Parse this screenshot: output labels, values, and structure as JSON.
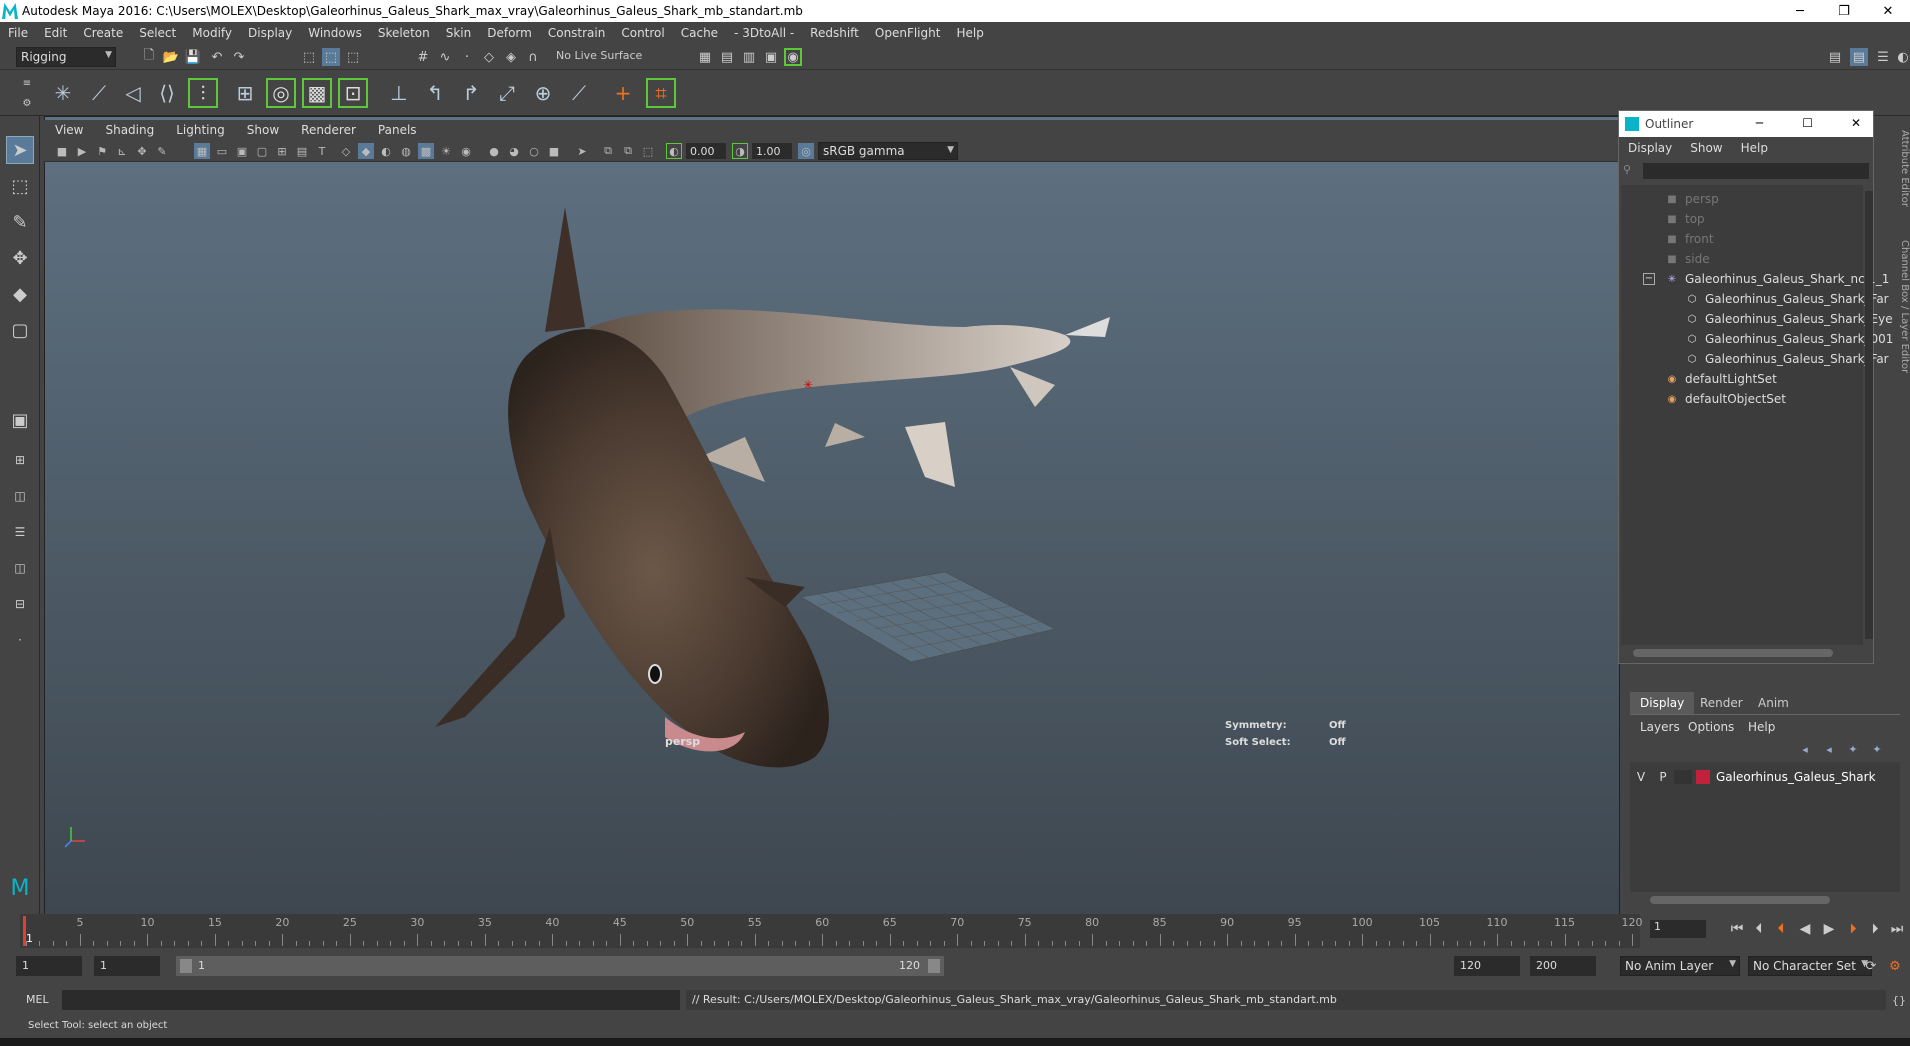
{
  "window": {
    "title": "Autodesk Maya 2016: C:\\Users\\MOLEX\\Desktop\\Galeorhinus_Galeus_Shark_max_vray\\Galeorhinus_Galeus_Shark_mb_standart.mb",
    "minimize": "─",
    "restore": "❐",
    "close": "✕"
  },
  "menubar": [
    "File",
    "Edit",
    "Create",
    "Select",
    "Modify",
    "Display",
    "Windows",
    "Skeleton",
    "Skin",
    "Deform",
    "Constrain",
    "Control",
    "Cache",
    "- 3DtoAll -",
    "Redshift",
    "OpenFlight",
    "Help"
  ],
  "statusline": {
    "menu_set": "Rigging",
    "live_surface": "No Live Surface"
  },
  "viewport": {
    "menu": [
      "View",
      "Shading",
      "Lighting",
      "Show",
      "Renderer",
      "Panels"
    ],
    "field_a": "0.00",
    "field_b": "1.00",
    "color_space": "sRGB gamma",
    "camera_label": "persp",
    "symmetry_label": "Symmetry:",
    "symmetry_value": "Off",
    "soft_select_label": "Soft Select:",
    "soft_select_value": "Off"
  },
  "outliner": {
    "title": "Outliner",
    "menu": [
      "Display",
      "Show",
      "Help"
    ],
    "items": [
      {
        "label": "persp",
        "icon": "camera-icon"
      },
      {
        "label": "top",
        "icon": "camera-icon"
      },
      {
        "label": "front",
        "icon": "camera-icon"
      },
      {
        "label": "side",
        "icon": "camera-icon"
      },
      {
        "label": "Galeorhinus_Galeus_Shark_ncl1_1",
        "icon": "joint-icon"
      },
      {
        "label": "Galeorhinus_Galeus_Shark_Far",
        "icon": "mesh-icon"
      },
      {
        "label": "Galeorhinus_Galeus_Shark_Eye",
        "icon": "mesh-icon"
      },
      {
        "label": "Galeorhinus_Galeus_Shark_001",
        "icon": "mesh-icon"
      },
      {
        "label": "Galeorhinus_Galeus_Shark_Far",
        "icon": "mesh-icon"
      },
      {
        "label": "defaultLightSet",
        "icon": "set-icon"
      },
      {
        "label": "defaultObjectSet",
        "icon": "set-icon"
      }
    ]
  },
  "side_tabs": {
    "attribute_editor": "Attribute Editor",
    "channel_box": "Channel Box / Layer Editor"
  },
  "layer_editor": {
    "tabs": [
      "Display",
      "Render",
      "Anim"
    ],
    "menu": [
      "Layers",
      "Options",
      "Help"
    ],
    "layer": {
      "v": "V",
      "p": "P",
      "name": "Galeorhinus_Galeus_Shark",
      "color": "#c0213b"
    }
  },
  "timeline": {
    "ticks": [
      5,
      10,
      15,
      20,
      25,
      30,
      35,
      40,
      45,
      50,
      55,
      60,
      65,
      70,
      75,
      80,
      85,
      90,
      95,
      100,
      105,
      110,
      115,
      120
    ],
    "first_mark": "1",
    "current_frame": "1"
  },
  "range": {
    "start": "1",
    "playback_start": "1",
    "slider_start": "1",
    "slider_end": "120",
    "playback_end": "120",
    "end": "200",
    "anim_layer": "No Anim Layer",
    "character_set": "No Character Set"
  },
  "command": {
    "lang": "MEL",
    "result": "// Result: C:/Users/MOLEX/Desktop/Galeorhinus_Galeus_Shark_max_vray/Galeorhinus_Galeus_Shark_mb_standart.mb"
  },
  "helpline": "Select Tool: select an object",
  "colors": {
    "accent": "#5a7a9a",
    "shelf_outline": "#5cc83a",
    "playhead": "#e0402f"
  }
}
